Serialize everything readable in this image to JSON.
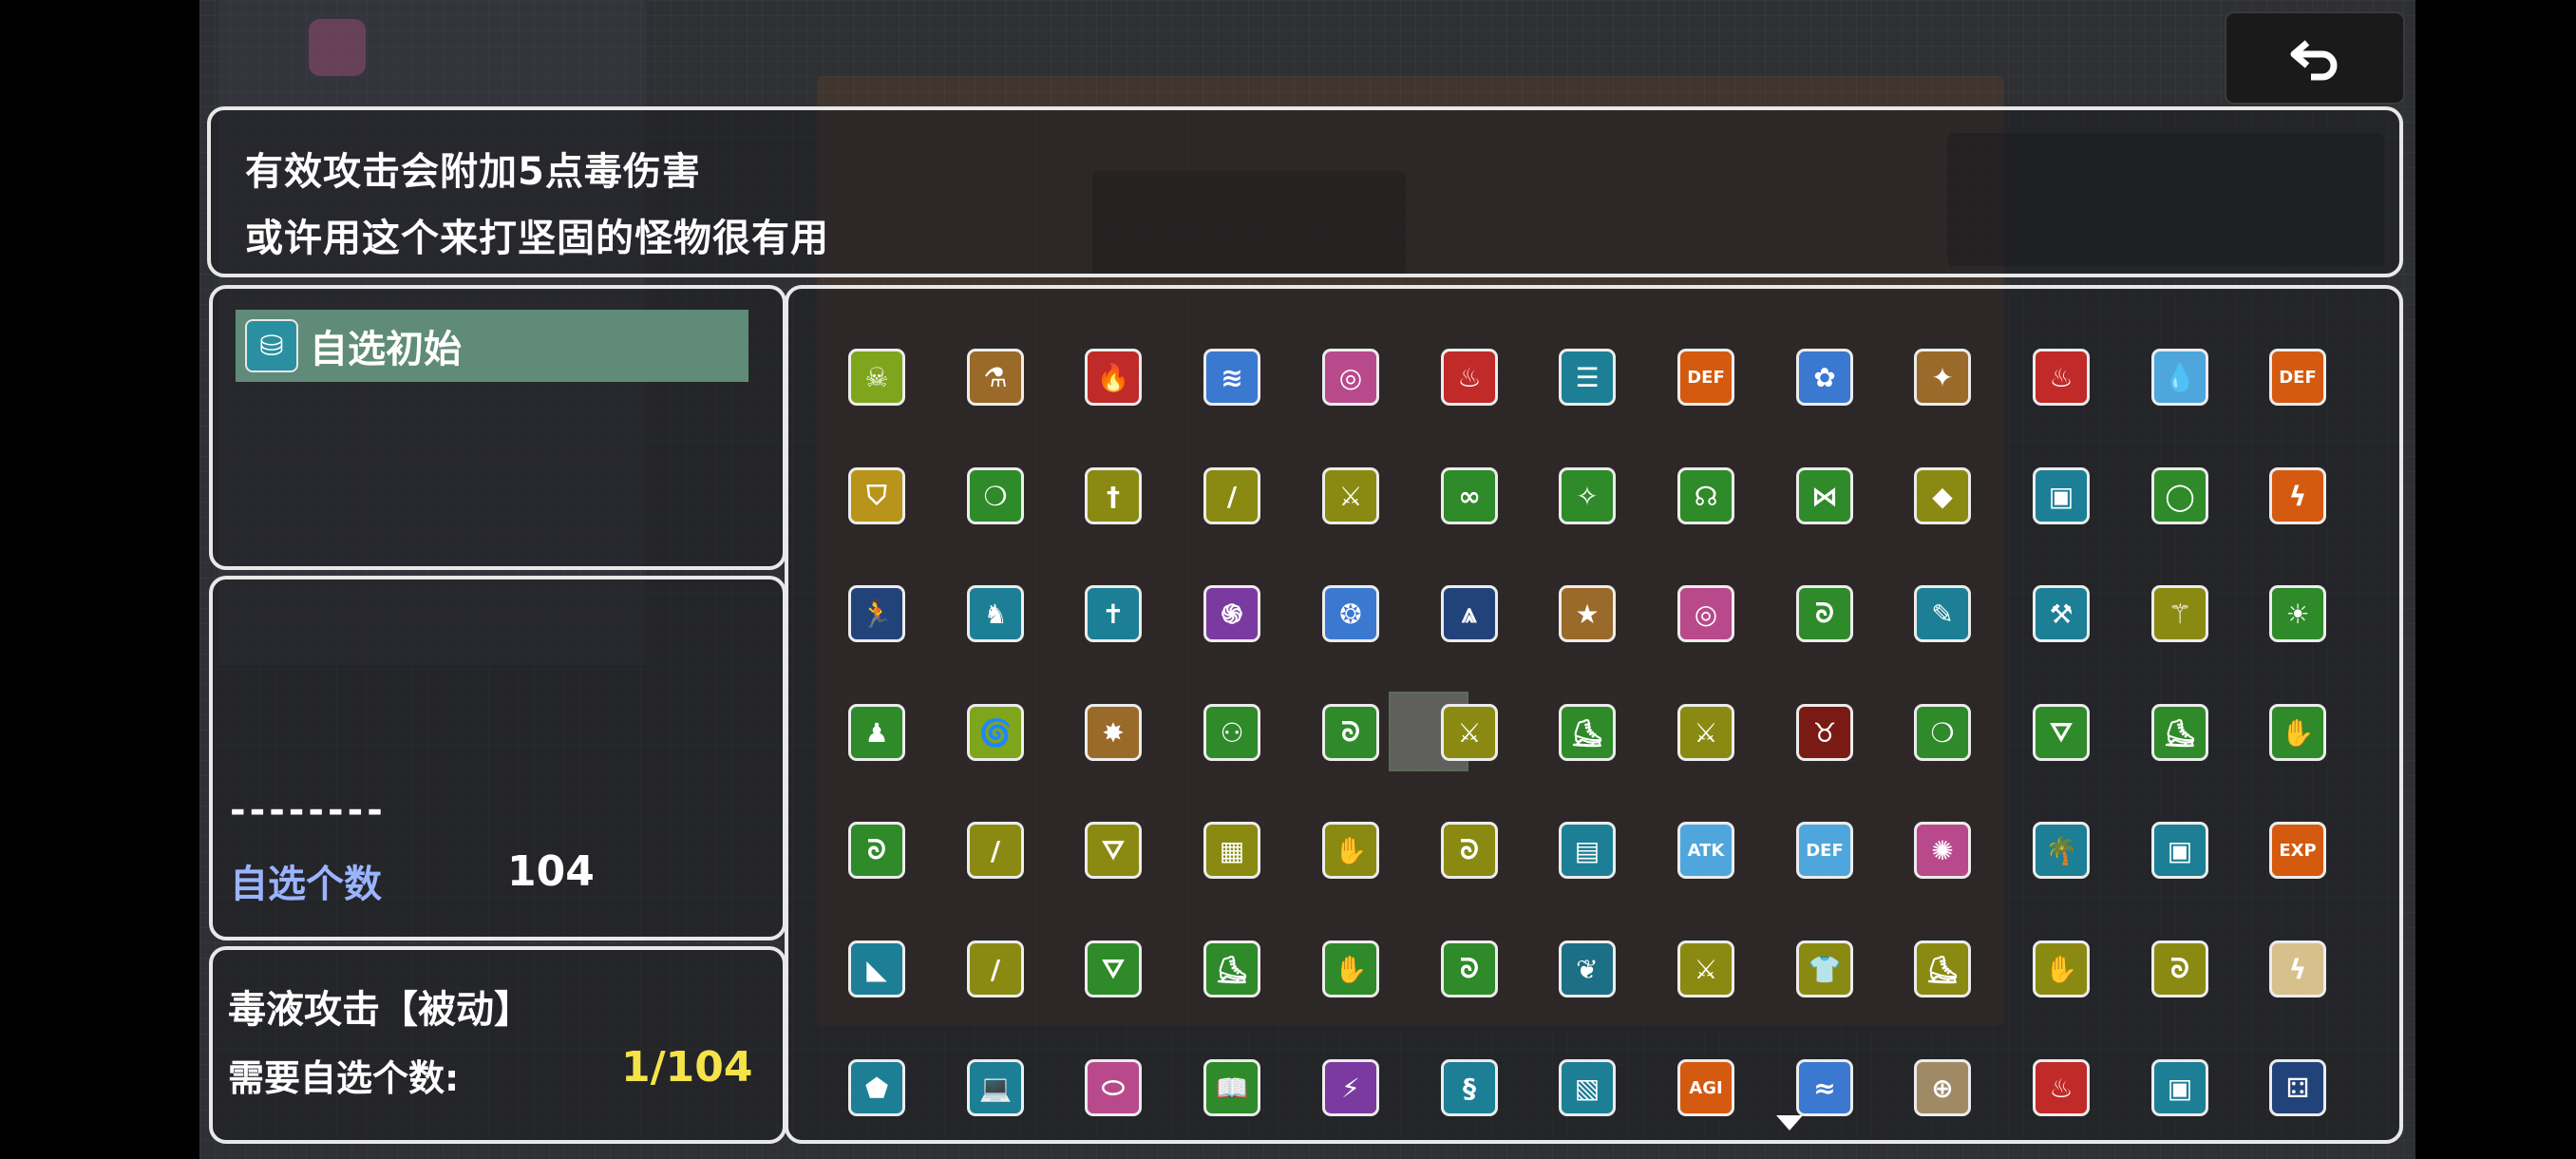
{
  "description": {
    "line1": "有效攻击会附加5点毒伤害",
    "line2": "或许用这个来打坚固的怪物很有用"
  },
  "category": {
    "label": "自选初始",
    "icon": "chest-icon"
  },
  "info": {
    "dashes": "--------",
    "count_label": "自选个数",
    "count_value": "104"
  },
  "skill": {
    "name": "毒液攻击【被动】",
    "need_label": "需要自选个数:",
    "need_value": "1/104"
  },
  "back_button": {
    "icon": "back-arrow-icon"
  },
  "selected_index": 42,
  "colors": {
    "green": "#7fa51d",
    "olive": "#8a8a12",
    "teal": "#1d7f95",
    "orange": "#d45a10",
    "red": "#c02a28",
    "blue": "#3b78d0",
    "pink": "#b84a8c",
    "brown": "#9a6a2a",
    "dkgreen": "#2f8a2a",
    "tan": "#a08a66",
    "navy": "#22437a",
    "purple": "#7a3aa0",
    "darkred": "#7a1a14",
    "sky": "#4ea6dc",
    "gold": "#b8941a",
    "beige": "#d8c08c",
    "dteal": "#1d6f86"
  },
  "icons": [
    {
      "name": "poison-drip-icon",
      "color": "green",
      "glyph": "☠"
    },
    {
      "name": "pouring-icon",
      "color": "brown",
      "glyph": "⚗"
    },
    {
      "name": "fire-icon",
      "color": "red",
      "glyph": "🔥"
    },
    {
      "name": "lightning-strike-icon",
      "color": "blue",
      "glyph": "≋"
    },
    {
      "name": "spiral-ring-icon",
      "color": "pink",
      "glyph": "◎"
    },
    {
      "name": "fire-x2-icon",
      "color": "red",
      "glyph": "♨"
    },
    {
      "name": "scroll-icon",
      "color": "teal",
      "glyph": "☰"
    },
    {
      "name": "def-up-icon",
      "color": "orange",
      "glyph": "DEF"
    },
    {
      "name": "flower-gem-icon",
      "color": "blue",
      "glyph": "✿"
    },
    {
      "name": "claw-icon",
      "color": "brown",
      "glyph": "✦"
    },
    {
      "name": "flame-burst-icon",
      "color": "red",
      "glyph": "♨"
    },
    {
      "name": "water-drop-icon",
      "color": "sky",
      "glyph": "💧"
    },
    {
      "name": "def-up-icon",
      "color": "orange",
      "glyph": "DEF"
    },
    {
      "name": "shield-icon",
      "color": "gold",
      "glyph": "⛉"
    },
    {
      "name": "balloon-icon",
      "color": "dkgreen",
      "glyph": "❍"
    },
    {
      "name": "dagger-icon",
      "color": "olive",
      "glyph": "†"
    },
    {
      "name": "knife-icon",
      "color": "olive",
      "glyph": "/"
    },
    {
      "name": "sword-icon",
      "color": "olive",
      "glyph": "⚔"
    },
    {
      "name": "goggles-icon",
      "color": "dkgreen",
      "glyph": "∞"
    },
    {
      "name": "torch-icon",
      "color": "dkgreen",
      "glyph": "✧"
    },
    {
      "name": "helmet-icon",
      "color": "dkgreen",
      "glyph": "☊"
    },
    {
      "name": "bow-ribbon-icon",
      "color": "dkgreen",
      "glyph": "⋈"
    },
    {
      "name": "book-icon",
      "color": "olive",
      "glyph": "◆"
    },
    {
      "name": "potion-jar-icon",
      "color": "teal",
      "glyph": "▣"
    },
    {
      "name": "ring-icon",
      "color": "dkgreen",
      "glyph": "◯"
    },
    {
      "name": "thunder-icon",
      "color": "orange",
      "glyph": "ϟ"
    },
    {
      "name": "running-man-icon",
      "color": "navy",
      "glyph": "🏃"
    },
    {
      "name": "piggy-bank-icon",
      "color": "teal",
      "glyph": "♞"
    },
    {
      "name": "cross-icon",
      "color": "teal",
      "glyph": "✝"
    },
    {
      "name": "vortex-icon",
      "color": "purple",
      "glyph": "֍"
    },
    {
      "name": "water-swirl-icon",
      "color": "blue",
      "glyph": "❂"
    },
    {
      "name": "angel-wings-icon",
      "color": "navy",
      "glyph": "⩓"
    },
    {
      "name": "star-icon",
      "color": "brown",
      "glyph": "★"
    },
    {
      "name": "pink-spiral-icon",
      "color": "pink",
      "glyph": "◎"
    },
    {
      "name": "green-swirl-icon",
      "color": "dkgreen",
      "glyph": "ᘐ"
    },
    {
      "name": "flashlight-icon",
      "color": "teal",
      "glyph": "✎"
    },
    {
      "name": "hammer-icon",
      "color": "teal",
      "glyph": "⚒"
    },
    {
      "name": "scythe-icon",
      "color": "olive",
      "glyph": "⚚"
    },
    {
      "name": "sun-burst-icon",
      "color": "dkgreen",
      "glyph": "☀"
    },
    {
      "name": "runner-hood-icon",
      "color": "dkgreen",
      "glyph": "♟"
    },
    {
      "name": "tornado-icon",
      "color": "green",
      "glyph": "🌀"
    },
    {
      "name": "explosion-icon",
      "color": "brown",
      "glyph": "✸"
    },
    {
      "name": "bubbles-icon",
      "color": "dkgreen",
      "glyph": "⚇"
    },
    {
      "name": "green-swirl-icon",
      "color": "dkgreen",
      "glyph": "ᘐ"
    },
    {
      "name": "sword-icon",
      "color": "olive",
      "glyph": "⚔"
    },
    {
      "name": "boots-icon",
      "color": "dkgreen",
      "glyph": "⛸"
    },
    {
      "name": "sword-icon",
      "color": "olive",
      "glyph": "⚔"
    },
    {
      "name": "demon-mask-icon",
      "color": "darkred",
      "glyph": "♉"
    },
    {
      "name": "balloon-icon",
      "color": "dkgreen",
      "glyph": "❍"
    },
    {
      "name": "witch-hat-icon",
      "color": "dkgreen",
      "glyph": "⛛"
    },
    {
      "name": "boots-icon",
      "color": "dkgreen",
      "glyph": "⛸"
    },
    {
      "name": "glove-icon",
      "color": "dkgreen",
      "glyph": "✋"
    },
    {
      "name": "green-swirl-icon",
      "color": "dkgreen",
      "glyph": "ᘐ"
    },
    {
      "name": "knife-icon",
      "color": "olive",
      "glyph": "/"
    },
    {
      "name": "witch-hat-icon",
      "color": "olive",
      "glyph": "⛛"
    },
    {
      "name": "armor-icon",
      "color": "olive",
      "glyph": "▦"
    },
    {
      "name": "glove-icon",
      "color": "olive",
      "glyph": "✋"
    },
    {
      "name": "green-swirl-icon",
      "color": "olive",
      "glyph": "ᘐ"
    },
    {
      "name": "tablet-icon",
      "color": "teal",
      "glyph": "▤"
    },
    {
      "name": "atk-up-icon",
      "color": "sky",
      "glyph": "ATK"
    },
    {
      "name": "def-up-icon",
      "color": "sky",
      "glyph": "DEF"
    },
    {
      "name": "pink-sparkle-icon",
      "color": "pink",
      "glyph": "✺"
    },
    {
      "name": "palm-tree-icon",
      "color": "teal",
      "glyph": "🌴"
    },
    {
      "name": "device-icon",
      "color": "teal",
      "glyph": "▣"
    },
    {
      "name": "exp-up-icon",
      "color": "orange",
      "glyph": "EXP"
    },
    {
      "name": "slope-icon",
      "color": "teal",
      "glyph": "◣"
    },
    {
      "name": "knife-icon",
      "color": "olive",
      "glyph": "/"
    },
    {
      "name": "witch-hat-icon",
      "color": "dkgreen",
      "glyph": "⛛"
    },
    {
      "name": "boots-icon",
      "color": "dkgreen",
      "glyph": "⛸"
    },
    {
      "name": "glove-icon",
      "color": "dkgreen",
      "glyph": "✋"
    },
    {
      "name": "green-swirl-icon",
      "color": "dkgreen",
      "glyph": "ᘐ"
    },
    {
      "name": "branch-icon",
      "color": "dteal",
      "glyph": "❦"
    },
    {
      "name": "sword-icon",
      "color": "olive",
      "glyph": "⚔"
    },
    {
      "name": "shirt-icon",
      "color": "olive",
      "glyph": "👕"
    },
    {
      "name": "boots-icon",
      "color": "olive",
      "glyph": "⛸"
    },
    {
      "name": "glove-icon",
      "color": "olive",
      "glyph": "✋"
    },
    {
      "name": "green-swirl-icon",
      "color": "olive",
      "glyph": "ᘐ"
    },
    {
      "name": "thunder-icon",
      "color": "beige",
      "glyph": "ϟ"
    },
    {
      "name": "dodecahedron-icon",
      "color": "teal",
      "glyph": "⬟"
    },
    {
      "name": "laptop-icon",
      "color": "teal",
      "glyph": "💻"
    },
    {
      "name": "pink-disc-icon",
      "color": "pink",
      "glyph": "⬭"
    },
    {
      "name": "open-book-icon",
      "color": "dkgreen",
      "glyph": "📖"
    },
    {
      "name": "magic-wand-icon",
      "color": "purple",
      "glyph": "⚡"
    },
    {
      "name": "wind-scroll-icon",
      "color": "teal",
      "glyph": "§"
    },
    {
      "name": "map-icon",
      "color": "teal",
      "glyph": "▧"
    },
    {
      "name": "agi-up-icon",
      "color": "orange",
      "glyph": "AGI"
    },
    {
      "name": "wave-icon",
      "color": "blue",
      "glyph": "≈"
    },
    {
      "name": "target-icon",
      "color": "tan",
      "glyph": "⊕"
    },
    {
      "name": "red-flame-icon",
      "color": "red",
      "glyph": "♨"
    },
    {
      "name": "potion-jar-icon",
      "color": "teal",
      "glyph": "▣"
    },
    {
      "name": "dice-icon",
      "color": "navy",
      "glyph": "⚃"
    }
  ]
}
